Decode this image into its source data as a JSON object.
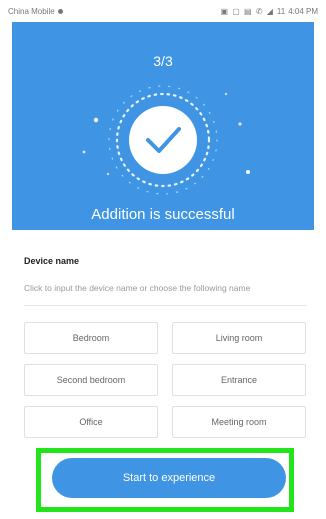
{
  "status_bar": {
    "carrier": "China Mobile",
    "icons": "signal-icons",
    "time": "4:04 PM",
    "battery": "11"
  },
  "hero": {
    "step": "3/3",
    "success_text": "Addition is successful",
    "background_color": "#3f95e4",
    "icon": "check-circle-icon"
  },
  "device_name": {
    "title": "Device name",
    "hint": "Click to input the device name or choose the following name",
    "options": [
      "Bedroom",
      "Living room",
      "Second bedroom",
      "Entrance",
      "Office",
      "Meeting room"
    ]
  },
  "cta": {
    "label": "Start to experience",
    "highlight_color": "#22e41b"
  }
}
